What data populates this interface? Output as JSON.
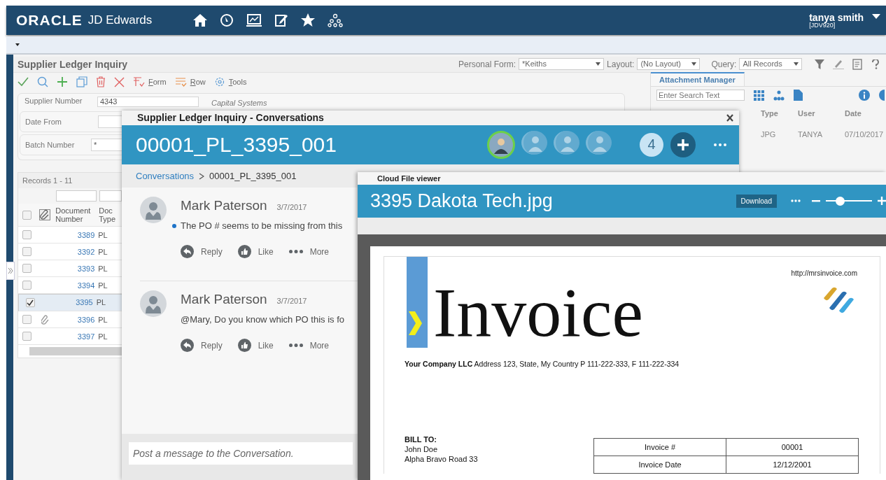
{
  "header": {
    "logo": "ORACLE",
    "product": "JD Edwards",
    "user": "tanya smith",
    "environment": "[JDV920]"
  },
  "form": {
    "title": "Supplier Ledger Inquiry",
    "personal_form_label": "Personal Form:",
    "personal_form": "*Keiths",
    "layout_label": "Layout:",
    "layout": "(No Layout)",
    "query_label": "Query:",
    "query": "All Records",
    "toolbar": [
      {
        "label": "Form"
      },
      {
        "label": "Row"
      },
      {
        "label": "Tools"
      }
    ],
    "fields": [
      {
        "label": "Supplier Number",
        "value": "4343"
      },
      {
        "label": "Date From"
      },
      {
        "label": "Batch Number",
        "value": "*"
      }
    ],
    "supplier_name": "Capital Systems",
    "records": "Records 1 - 11",
    "all_selected": false,
    "columns": [
      "Document Number",
      "Doc Type"
    ],
    "rows": [
      {
        "number": "3389",
        "type": "PL",
        "selected": false,
        "attachment": false
      },
      {
        "number": "3392",
        "type": "PL",
        "selected": false,
        "attachment": false
      },
      {
        "number": "3393",
        "type": "PL",
        "selected": false,
        "attachment": false
      },
      {
        "number": "3394",
        "type": "PL",
        "selected": false,
        "attachment": false
      },
      {
        "number": "3395",
        "type": "PL",
        "selected": true,
        "attachment": false
      },
      {
        "number": "3396",
        "type": "PL",
        "selected": false,
        "attachment": true
      },
      {
        "number": "3397",
        "type": "PL",
        "selected": false,
        "attachment": false
      }
    ]
  },
  "attachments": {
    "tab": "Attachment Manager",
    "search_placeholder": "Enter Search Text",
    "columns": [
      "Type",
      "User",
      "Date"
    ],
    "rows": [
      {
        "type": "JPG",
        "user": "TANYA",
        "date": "07/10/2017"
      }
    ]
  },
  "conversation": {
    "window_title": "Supplier Ledger Inquiry - Conversations",
    "title": "00001_PL_3395_001",
    "participants": [
      {
        "online": true
      },
      {
        "online": false
      },
      {
        "online": false
      },
      {
        "online": false
      }
    ],
    "participant_count": "4",
    "breadcrumb": [
      "Conversations",
      "00001_PL_3395_001"
    ],
    "messages": [
      {
        "author": "Mark Paterson",
        "date": "3/7/2017",
        "text": "The PO # seems to be missing from this",
        "unread": true,
        "actions": [
          "Reply",
          "Like",
          "More"
        ]
      },
      {
        "author": "Mark Paterson",
        "date": "3/7/2017",
        "text": "@Mary, Do you know which PO this is fo",
        "unread": false,
        "actions": [
          "Reply",
          "Like",
          "More"
        ]
      }
    ],
    "composer_placeholder": "Post a message to the Conversation."
  },
  "viewer": {
    "window_title": "Cloud File viewer",
    "file": "3395 Dakota Tech.jpg",
    "download": "Download",
    "zoom": {
      "level": 0.3
    },
    "document": {
      "url": "http://mrsinvoice.com",
      "heading": "Invoice",
      "company_line": "**Your Company LLC** Address 123, State, My Country P 111-222-333, F 111-222-334",
      "bill_to_label": "BILL TO:",
      "bill_to": [
        "John Doe",
        "Alpha Bravo Road 33"
      ],
      "table": [
        [
          "Invoice #",
          "00001"
        ],
        [
          "Invoice Date",
          "12/12/2001"
        ]
      ]
    }
  }
}
